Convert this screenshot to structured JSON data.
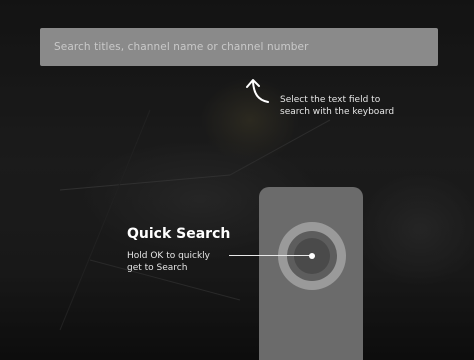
{
  "search": {
    "placeholder": "Search titles, channel name or channel number"
  },
  "hint": {
    "line1": "Select the text field to",
    "line2": "search with the keyboard",
    "arrow_icon": "curved-arrow-up-icon"
  },
  "quick_search": {
    "title": "Quick Search",
    "line1": "Hold OK to quickly",
    "line2": "get to Search"
  },
  "colors": {
    "field_bg": "#8a8a8a",
    "remote_body": "#6b6b6b",
    "text_primary": "#ffffff"
  }
}
